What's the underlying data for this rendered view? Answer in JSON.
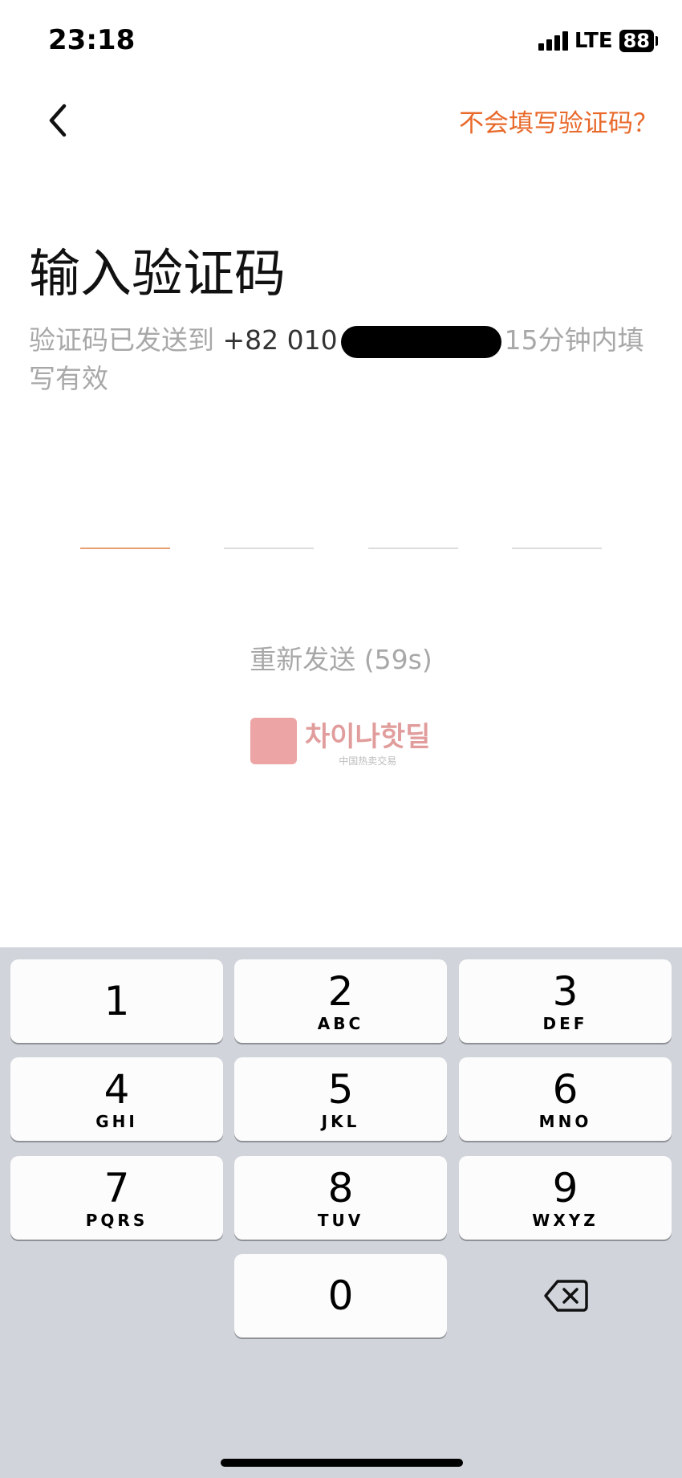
{
  "status": {
    "time": "23:18",
    "network": "LTE",
    "battery": "88"
  },
  "nav": {
    "help_link": "不会填写验证码？"
  },
  "title": "输入验证码",
  "description": {
    "prefix": "验证码已发送到",
    "phone": "+82 010",
    "suffix": "15分钟内填写有效"
  },
  "code_slots": 4,
  "resend_label": "重新发送 (59s)",
  "watermark": {
    "main": "차이나핫딜",
    "sub": "中国热卖交易"
  },
  "keypad": [
    {
      "digit": "1",
      "letters": ""
    },
    {
      "digit": "2",
      "letters": "ABC"
    },
    {
      "digit": "3",
      "letters": "DEF"
    },
    {
      "digit": "4",
      "letters": "GHI"
    },
    {
      "digit": "5",
      "letters": "JKL"
    },
    {
      "digit": "6",
      "letters": "MNO"
    },
    {
      "digit": "7",
      "letters": "PQRS"
    },
    {
      "digit": "8",
      "letters": "TUV"
    },
    {
      "digit": "9",
      "letters": "WXYZ"
    },
    {
      "digit": "0",
      "letters": ""
    }
  ],
  "colors": {
    "accent": "#e8692a",
    "muted": "#a8a8a8",
    "keypad_bg": "#d1d4db"
  }
}
